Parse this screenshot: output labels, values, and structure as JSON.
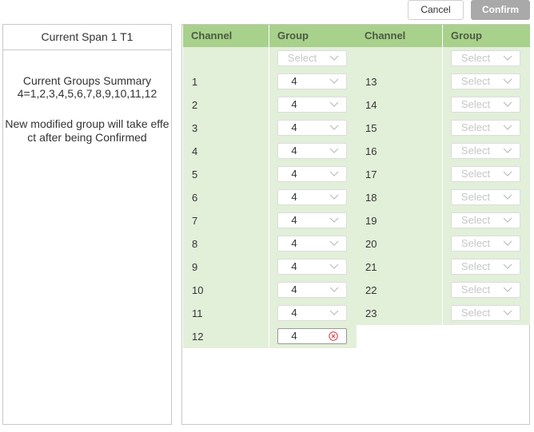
{
  "toolbar": {
    "cancel_label": "Cancel",
    "confirm_label": "Confirm"
  },
  "left_panel": {
    "title": "Current Span 1 T1",
    "summary_title": "Current Groups Summary",
    "summary_value": "4=1,2,3,4,5,6,7,8,9,10,11,12",
    "note": "New modified group will take effect after being Confirmed"
  },
  "table": {
    "headers": {
      "channel": "Channel",
      "group": "Group"
    },
    "left_rows": [
      {
        "channel": "",
        "group": "Select",
        "placeholder": true
      },
      {
        "channel": "1",
        "group": "4"
      },
      {
        "channel": "2",
        "group": "4"
      },
      {
        "channel": "3",
        "group": "4"
      },
      {
        "channel": "4",
        "group": "4"
      },
      {
        "channel": "5",
        "group": "4"
      },
      {
        "channel": "6",
        "group": "4"
      },
      {
        "channel": "7",
        "group": "4"
      },
      {
        "channel": "8",
        "group": "4"
      },
      {
        "channel": "9",
        "group": "4"
      },
      {
        "channel": "10",
        "group": "4"
      },
      {
        "channel": "11",
        "group": "4"
      },
      {
        "channel": "12",
        "group": "4",
        "clear": true
      }
    ],
    "right_rows": [
      {
        "channel": "",
        "group": "Select",
        "placeholder": true
      },
      {
        "channel": "13",
        "group": "Select",
        "placeholder": true
      },
      {
        "channel": "14",
        "group": "Select",
        "placeholder": true
      },
      {
        "channel": "15",
        "group": "Select",
        "placeholder": true
      },
      {
        "channel": "16",
        "group": "Select",
        "placeholder": true
      },
      {
        "channel": "17",
        "group": "Select",
        "placeholder": true
      },
      {
        "channel": "18",
        "group": "Select",
        "placeholder": true
      },
      {
        "channel": "19",
        "group": "Select",
        "placeholder": true
      },
      {
        "channel": "20",
        "group": "Select",
        "placeholder": true
      },
      {
        "channel": "21",
        "group": "Select",
        "placeholder": true
      },
      {
        "channel": "22",
        "group": "Select",
        "placeholder": true
      },
      {
        "channel": "23",
        "group": "Select",
        "placeholder": true
      }
    ]
  },
  "colors": {
    "header_bg": "#a8d18c",
    "row_bg": "#e2efd9",
    "clear_icon": "#e0303a"
  }
}
